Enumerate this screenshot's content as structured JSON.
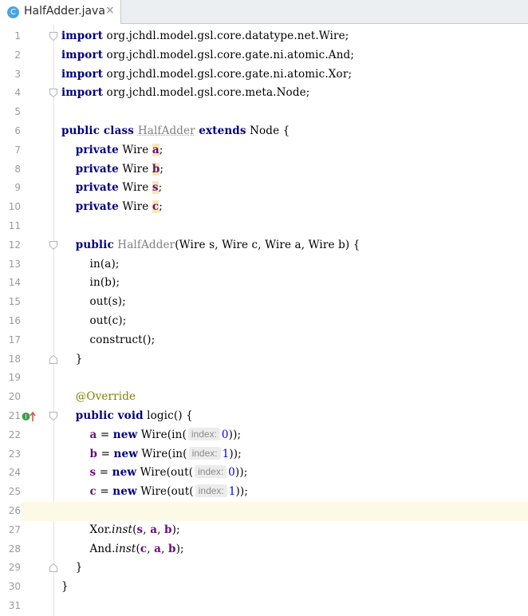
{
  "tab": {
    "title": "HalfAdder.java",
    "close": "×",
    "icon_letter": "C"
  },
  "lines": [
    {
      "n": "1",
      "fold": "start",
      "tokens": [
        {
          "c": "kw",
          "t": "import"
        },
        {
          "t": " org.jchdl.model.gsl.core.datatype.net.Wire;"
        }
      ]
    },
    {
      "n": "2",
      "tokens": [
        {
          "c": "kw",
          "t": "import"
        },
        {
          "t": " org.jchdl.model.gsl.core.gate.ni.atomic.And;"
        }
      ]
    },
    {
      "n": "3",
      "tokens": [
        {
          "c": "kw",
          "t": "import"
        },
        {
          "t": " org.jchdl.model.gsl.core.gate.ni.atomic.Xor;"
        }
      ]
    },
    {
      "n": "4",
      "fold": "start",
      "tokens": [
        {
          "c": "kw",
          "t": "import"
        },
        {
          "t": " org.jchdl.model.gsl.core.meta.Node;"
        }
      ]
    },
    {
      "n": "5",
      "tokens": []
    },
    {
      "n": "6",
      "tokens": [
        {
          "c": "kw",
          "t": "public class "
        },
        {
          "c": "unused",
          "t": "HalfAdder"
        },
        {
          "t": " "
        },
        {
          "c": "kw",
          "t": "extends"
        },
        {
          "t": " Node {"
        }
      ]
    },
    {
      "n": "7",
      "tokens": [
        {
          "t": "    "
        },
        {
          "c": "kw",
          "t": "private"
        },
        {
          "t": " Wire "
        },
        {
          "c": "fld hl",
          "t": "a"
        },
        {
          "t": ";"
        }
      ]
    },
    {
      "n": "8",
      "tokens": [
        {
          "t": "    "
        },
        {
          "c": "kw",
          "t": "private"
        },
        {
          "t": " Wire "
        },
        {
          "c": "fld hl",
          "t": "b"
        },
        {
          "t": ";"
        }
      ]
    },
    {
      "n": "9",
      "tokens": [
        {
          "t": "    "
        },
        {
          "c": "kw",
          "t": "private"
        },
        {
          "t": " Wire "
        },
        {
          "c": "fld hl",
          "t": "s"
        },
        {
          "t": ";"
        }
      ]
    },
    {
      "n": "10",
      "tokens": [
        {
          "t": "    "
        },
        {
          "c": "kw",
          "t": "private"
        },
        {
          "t": " Wire "
        },
        {
          "c": "fld hl",
          "t": "c"
        },
        {
          "t": ";"
        }
      ]
    },
    {
      "n": "11",
      "tokens": []
    },
    {
      "n": "12",
      "fold": "start",
      "tokens": [
        {
          "t": "    "
        },
        {
          "c": "kw",
          "t": "public"
        },
        {
          "t": " "
        },
        {
          "c": "gray",
          "t": "HalfAdder"
        },
        {
          "t": "(Wire s, Wire c, Wire a, Wire b) {"
        }
      ]
    },
    {
      "n": "13",
      "tokens": [
        {
          "t": "        in(a);"
        }
      ]
    },
    {
      "n": "14",
      "tokens": [
        {
          "t": "        in(b);"
        }
      ]
    },
    {
      "n": "15",
      "tokens": [
        {
          "t": "        out(s);"
        }
      ]
    },
    {
      "n": "16",
      "tokens": [
        {
          "t": "        out(c);"
        }
      ]
    },
    {
      "n": "17",
      "tokens": [
        {
          "t": "        construct();"
        }
      ]
    },
    {
      "n": "18",
      "fold": "end",
      "tokens": [
        {
          "t": "    }"
        }
      ]
    },
    {
      "n": "19",
      "tokens": []
    },
    {
      "n": "20",
      "tokens": [
        {
          "t": "    "
        },
        {
          "c": "ann",
          "t": "@Override"
        }
      ]
    },
    {
      "n": "21",
      "fold": "start",
      "marker": true,
      "tokens": [
        {
          "t": "    "
        },
        {
          "c": "kw",
          "t": "public void"
        },
        {
          "t": " logic() {"
        }
      ]
    },
    {
      "n": "22",
      "tokens": [
        {
          "t": "        "
        },
        {
          "c": "fld",
          "t": "a"
        },
        {
          "t": " = "
        },
        {
          "c": "kw",
          "t": "new"
        },
        {
          "t": " Wire(in("
        },
        {
          "c": "hint",
          "t": "index:"
        },
        {
          "c": "num",
          "t": "0"
        },
        {
          "t": "));"
        }
      ]
    },
    {
      "n": "23",
      "tokens": [
        {
          "t": "        "
        },
        {
          "c": "fld",
          "t": "b"
        },
        {
          "t": " = "
        },
        {
          "c": "kw",
          "t": "new"
        },
        {
          "t": " Wire(in("
        },
        {
          "c": "hint",
          "t": "index:"
        },
        {
          "c": "num",
          "t": "1"
        },
        {
          "t": "));"
        }
      ]
    },
    {
      "n": "24",
      "tokens": [
        {
          "t": "        "
        },
        {
          "c": "fld",
          "t": "s"
        },
        {
          "t": " = "
        },
        {
          "c": "kw",
          "t": "new"
        },
        {
          "t": " Wire(out("
        },
        {
          "c": "hint",
          "t": "index:"
        },
        {
          "c": "num",
          "t": "0"
        },
        {
          "t": "));"
        }
      ]
    },
    {
      "n": "25",
      "tokens": [
        {
          "t": "        "
        },
        {
          "c": "fld",
          "t": "c"
        },
        {
          "t": " = "
        },
        {
          "c": "kw",
          "t": "new"
        },
        {
          "t": " Wire(out("
        },
        {
          "c": "hint",
          "t": "index:"
        },
        {
          "c": "num",
          "t": "1"
        },
        {
          "t": "));"
        }
      ]
    },
    {
      "n": "26",
      "current": true,
      "tokens": []
    },
    {
      "n": "27",
      "tokens": [
        {
          "t": "        Xor."
        },
        {
          "c": "ital",
          "t": "inst"
        },
        {
          "t": "("
        },
        {
          "c": "fld",
          "t": "s"
        },
        {
          "t": ", "
        },
        {
          "c": "fld",
          "t": "a"
        },
        {
          "t": ", "
        },
        {
          "c": "fld",
          "t": "b"
        },
        {
          "t": ");"
        }
      ]
    },
    {
      "n": "28",
      "tokens": [
        {
          "t": "        And."
        },
        {
          "c": "ital",
          "t": "inst"
        },
        {
          "t": "("
        },
        {
          "c": "fld",
          "t": "c"
        },
        {
          "t": ", "
        },
        {
          "c": "fld",
          "t": "a"
        },
        {
          "t": ", "
        },
        {
          "c": "fld",
          "t": "b"
        },
        {
          "t": ");"
        }
      ]
    },
    {
      "n": "29",
      "fold": "end",
      "tokens": [
        {
          "t": "    }"
        }
      ]
    },
    {
      "n": "30",
      "tokens": [
        {
          "t": "}"
        }
      ]
    },
    {
      "n": "31",
      "tokens": []
    }
  ]
}
